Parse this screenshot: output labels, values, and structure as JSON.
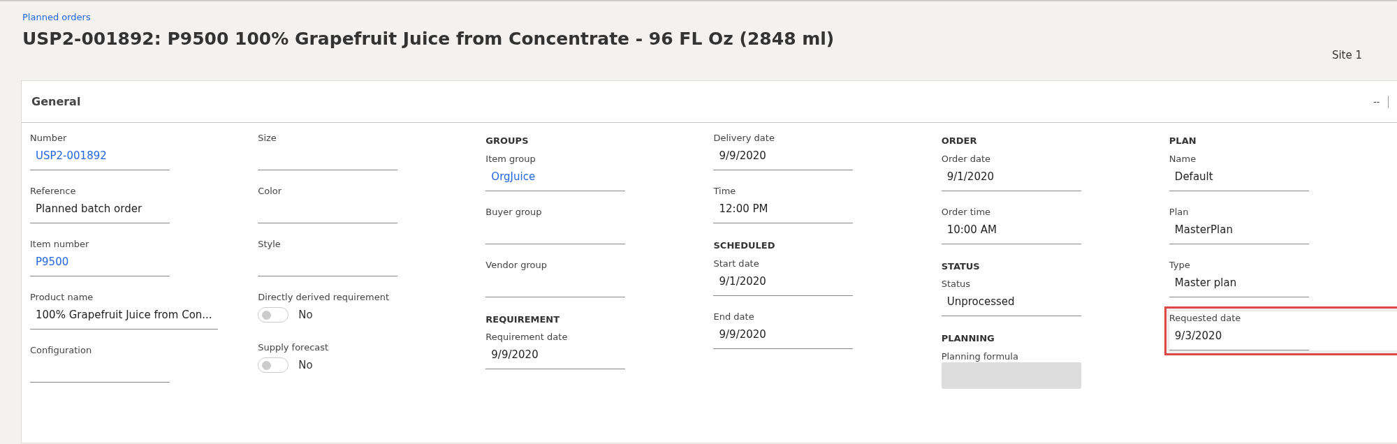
{
  "breadcrumb": "Planned orders",
  "title": "USP2-001892: P9500 100% Grapefruit Juice from Concentrate - 96 FL Oz (2848 ml)",
  "site": "Site 1",
  "section": {
    "title": "General",
    "collapse_text": "--",
    "columns": [
      {
        "items": [
          {
            "kind": "field",
            "label": "Number",
            "value": "USP2-001892",
            "link": true
          },
          {
            "kind": "field",
            "label": "Reference",
            "value": "Planned batch order",
            "link": false
          },
          {
            "kind": "field",
            "label": "Item number",
            "value": "P9500",
            "link": true
          },
          {
            "kind": "field",
            "label": "Product name",
            "value": "100% Grapefruit Juice from Con...",
            "link": false
          },
          {
            "kind": "field",
            "label": "Configuration"
          }
        ]
      },
      {
        "items": [
          {
            "kind": "field",
            "label": "Size"
          },
          {
            "kind": "field",
            "label": "Color"
          },
          {
            "kind": "field",
            "label": "Style"
          },
          {
            "kind": "toggle",
            "label": "Directly derived requirement",
            "value": "No",
            "on": false
          },
          {
            "kind": "toggle",
            "label": "Supply forecast",
            "value": "No",
            "on": false
          }
        ]
      },
      {
        "items": [
          {
            "kind": "heading",
            "label": "GROUPS"
          },
          {
            "kind": "field",
            "label": "Item group",
            "value": "OrgJuice",
            "link": true
          },
          {
            "kind": "field",
            "label": "Buyer group"
          },
          {
            "kind": "field",
            "label": "Vendor group"
          },
          {
            "kind": "heading",
            "label": "REQUIREMENT"
          },
          {
            "kind": "field",
            "label": "Requirement date",
            "value": "9/9/2020",
            "link": false
          }
        ]
      },
      {
        "items": [
          {
            "kind": "field",
            "label": "Delivery date",
            "value": "9/9/2020",
            "link": false
          },
          {
            "kind": "field",
            "label": "Time",
            "value": "12:00 PM",
            "link": false
          },
          {
            "kind": "heading",
            "label": "SCHEDULED"
          },
          {
            "kind": "field",
            "label": "Start date",
            "value": "9/1/2020",
            "link": false
          },
          {
            "kind": "field",
            "label": "End date",
            "value": "9/9/2020",
            "link": false
          }
        ]
      },
      {
        "items": [
          {
            "kind": "heading",
            "label": "ORDER"
          },
          {
            "kind": "field",
            "label": "Order date",
            "value": "9/1/2020",
            "link": false
          },
          {
            "kind": "field",
            "label": "Order time",
            "value": "10:00 AM",
            "link": false
          },
          {
            "kind": "heading",
            "label": "STATUS"
          },
          {
            "kind": "field",
            "label": "Status",
            "value": "Unprocessed",
            "link": false
          },
          {
            "kind": "heading",
            "label": "PLANNING"
          },
          {
            "kind": "field",
            "label": "Planning formula",
            "disabled": true
          }
        ]
      },
      {
        "items": [
          {
            "kind": "heading",
            "label": "PLAN"
          },
          {
            "kind": "field",
            "label": "Name",
            "value": "Default",
            "link": false
          },
          {
            "kind": "field",
            "label": "Plan",
            "value": "MasterPlan",
            "link": false
          },
          {
            "kind": "field",
            "label": "Type",
            "value": "Master plan",
            "link": false
          },
          {
            "kind": "field",
            "label": "Requested date",
            "value": "9/3/2020",
            "link": false,
            "highlighted": true
          }
        ]
      }
    ]
  }
}
